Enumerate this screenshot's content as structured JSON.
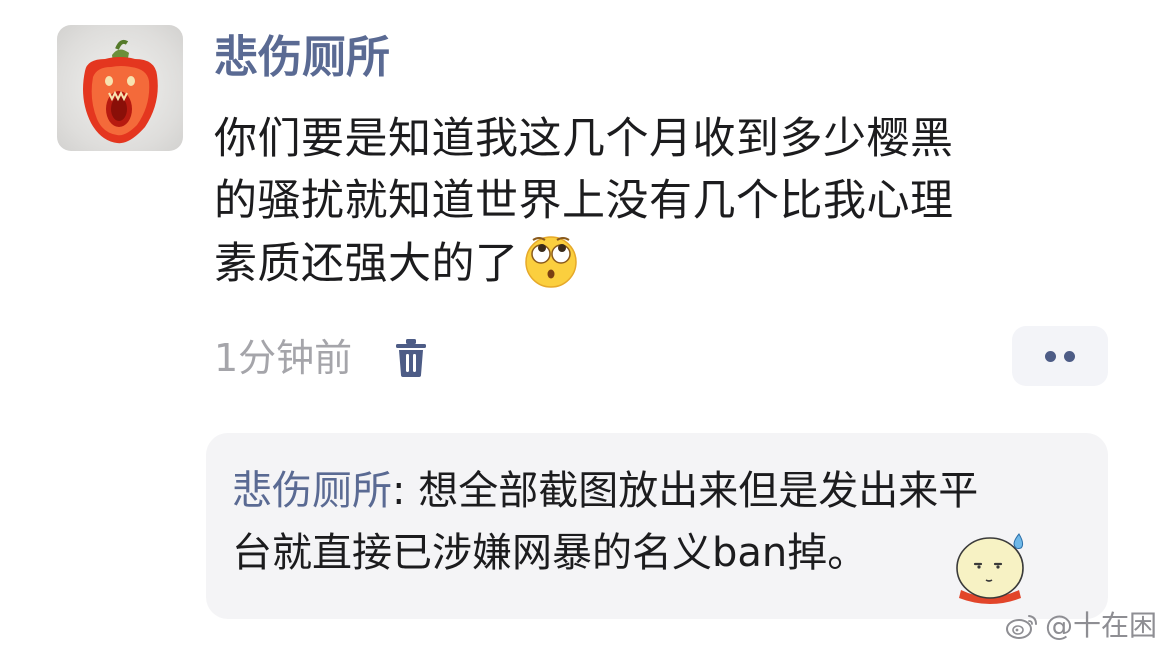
{
  "post": {
    "author": "悲伤厕所",
    "text_lines": [
      "你们要是知道我这几个月收到多少樱黑",
      "的骚扰就知道世界上没有几个比我心理",
      "素质还强大的了"
    ],
    "emoji": "eye-roll-emoji",
    "time": "1分钟前",
    "delete_icon": "trash-icon",
    "more_icon": "more-dots-icon"
  },
  "reply": {
    "author": "悲伤厕所",
    "separator": ": ",
    "line1_text": "想全部截图放出来但是发出来平",
    "line2_text": "台就直接已涉嫌网暴的名义ban掉。",
    "emoji": "sweat-face-sticker"
  },
  "watermark": {
    "icon": "weibo-icon",
    "text": "@十在困"
  },
  "colors": {
    "author": "#5a6a93",
    "text": "#1c1c1e",
    "meta": "#a5a5aa",
    "reply_bg": "#f4f4f6",
    "more_bg": "#f3f4f8",
    "icon": "#4d5c86"
  }
}
